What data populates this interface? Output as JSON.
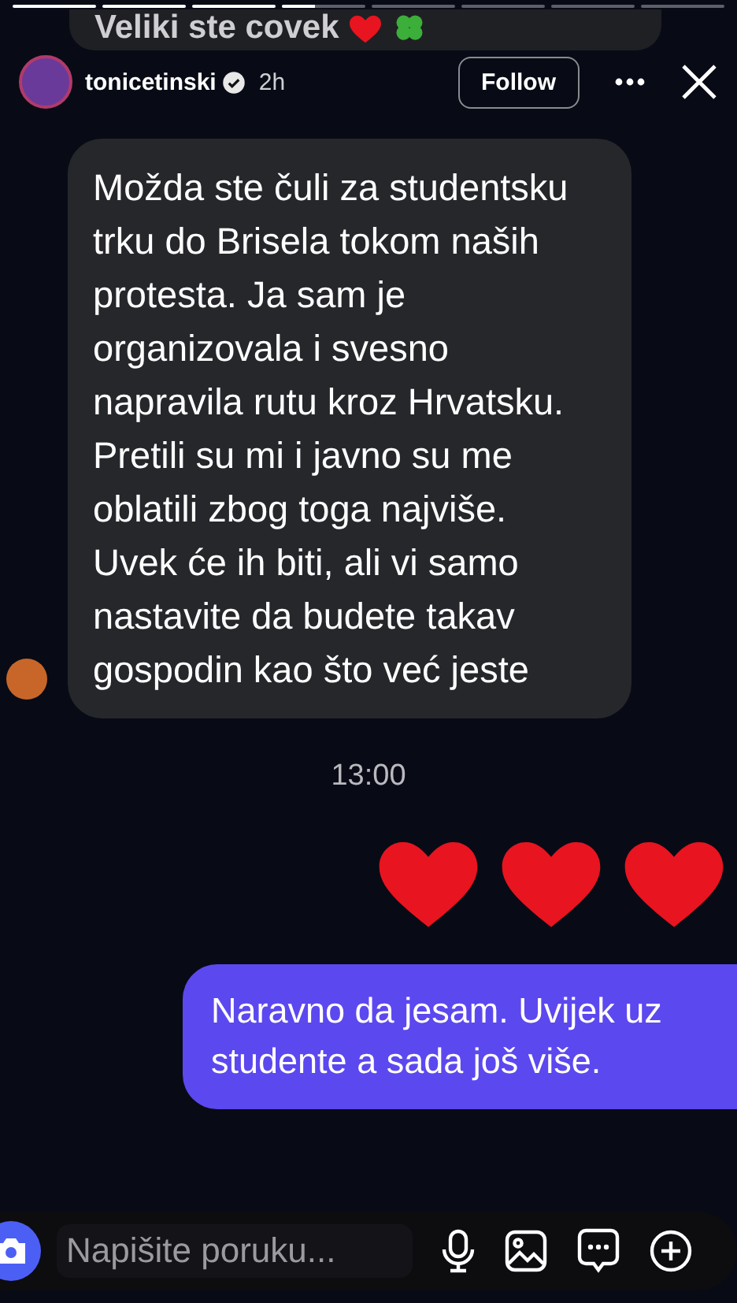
{
  "story_reply": {
    "text": "Veliki ste covek"
  },
  "story_progress": [
    {
      "level": 1
    },
    {
      "level": 1
    },
    {
      "level": 1
    },
    {
      "level": 0.4
    },
    {
      "level": 0
    },
    {
      "level": 0
    },
    {
      "level": 0
    },
    {
      "level": 0
    }
  ],
  "header": {
    "username": "tonicetinski",
    "verified": true,
    "time": "2h",
    "follow_button": "Follow"
  },
  "messages": [
    {
      "kind": "incoming",
      "text": "Možda ste čuli za studentsku trku do Brisela tokom naših protesta. Ja sam je organizovala i svesno napravila rutu kroz Hrvatsku. Pretili su mi i javno su me oblatili zbog toga najviše. Uvek će ih biti, ali vi samo nastavite da budete takav gospodin kao što već jeste"
    },
    {
      "kind": "timestamp",
      "text": "13:00"
    },
    {
      "kind": "heart_emoji"
    },
    {
      "kind": "heart_emoji"
    },
    {
      "kind": "heart_emoji"
    },
    {
      "kind": "outgoing",
      "text": "Naravno da jesam. Uvijek uz studente a sada još više."
    }
  ],
  "composer": {
    "placeholder": "Napišite poruku..."
  }
}
